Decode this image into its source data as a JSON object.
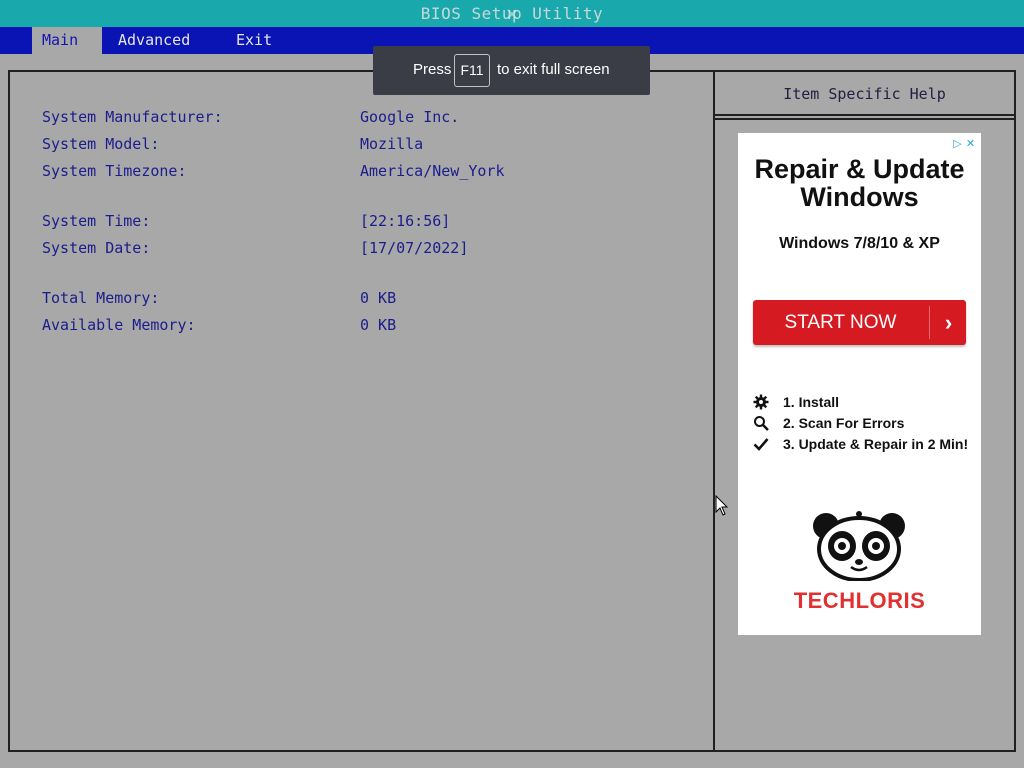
{
  "title_bar": {
    "title": "BIOS Setup Utility"
  },
  "menu": {
    "items": [
      {
        "label": "Main",
        "active": true
      },
      {
        "label": "Advanced",
        "active": false
      },
      {
        "label": "Exit",
        "active": false
      }
    ]
  },
  "fullscreen_toast": {
    "press": "Press",
    "key": "F11",
    "message": "to exit full screen"
  },
  "system_info": {
    "rows": [
      {
        "label": "System Manufacturer:",
        "value": "Google Inc."
      },
      {
        "label": "System Model:",
        "value": "Mozilla"
      },
      {
        "label": "System Timezone:",
        "value": "America/New_York"
      },
      {
        "label": "System Time:",
        "value": "[22:16:56]"
      },
      {
        "label": "System Date:",
        "value": "[17/07/2022]"
      },
      {
        "label": "Total Memory:",
        "value": "0 KB"
      },
      {
        "label": "Available Memory:",
        "value": "0 KB"
      }
    ]
  },
  "help_panel": {
    "header": "Item Specific Help"
  },
  "ad": {
    "headline_line1": "Repair & Update",
    "headline_line2": "Windows",
    "subheadline": "Windows 7/8/10 & XP",
    "cta_label": "START NOW",
    "cta_arrow": "›",
    "steps": [
      {
        "icon": "gear-icon",
        "text": "1. Install"
      },
      {
        "icon": "search-icon",
        "text": "2. Scan For Errors"
      },
      {
        "icon": "checkmark-icon",
        "text": "3. Update & Repair in 2 Min!"
      }
    ],
    "brand": "TECHLORIS",
    "choices_icons": [
      "adchoices-icon",
      "close-icon"
    ]
  },
  "colors": {
    "title_bar": "#19a9ad",
    "menu_bar": "#0a14b4",
    "background": "#a8a8a8",
    "text": "#1c1c8c",
    "cta": "#d61a22",
    "brand": "#e03030"
  }
}
